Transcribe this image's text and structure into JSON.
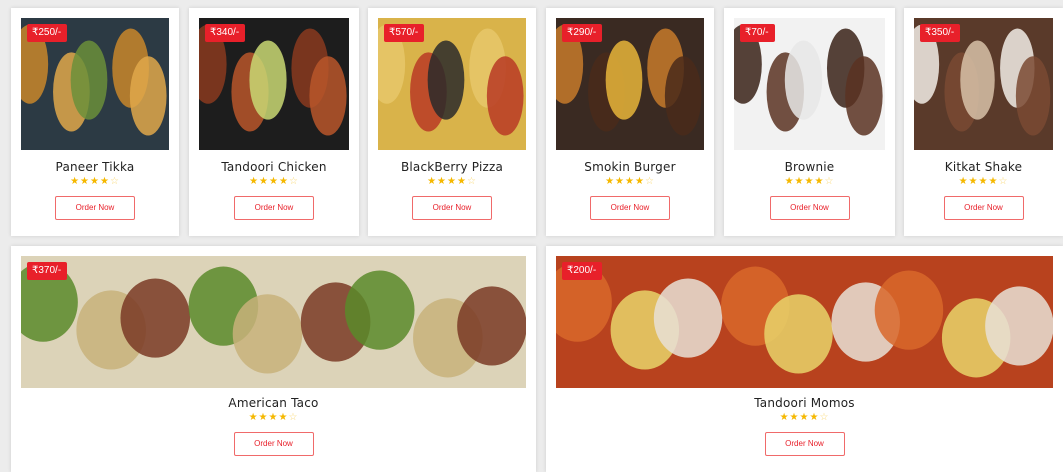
{
  "top_row": [
    {
      "name": "Paneer Tikka",
      "price": "₹250/-",
      "rating": 4,
      "order_label": "Order Now",
      "colors": [
        "#2c3a44",
        "#c9872a",
        "#e0a84a",
        "#6b8f3a"
      ]
    },
    {
      "name": "Tandoori Chicken",
      "price": "₹340/-",
      "rating": 4,
      "order_label": "Order Now",
      "colors": [
        "#1d1d1d",
        "#8a3a1e",
        "#b8562a",
        "#c9d873"
      ]
    },
    {
      "name": "BlackBerry Pizza",
      "price": "₹570/-",
      "rating": 4,
      "order_label": "Order Now",
      "colors": [
        "#d9b34a",
        "#e6c76a",
        "#b83a24",
        "#2a2a2a"
      ]
    },
    {
      "name": "Smokin Burger",
      "price": "₹290/-",
      "rating": 4,
      "order_label": "Order Now",
      "colors": [
        "#3a2a22",
        "#c77a2a",
        "#4a2a1a",
        "#e8b53a"
      ]
    },
    {
      "name": "Brownie",
      "price": "₹70/-",
      "rating": 4,
      "order_label": "Order Now",
      "colors": [
        "#f2f2f2",
        "#3a2218",
        "#5a3322",
        "#e8e8e8"
      ]
    },
    {
      "name": "Kitkat Shake",
      "price": "₹350/-",
      "rating": 4,
      "order_label": "Order Now",
      "colors": [
        "#5a3a2a",
        "#f2ede6",
        "#7a4a32",
        "#d8c2a8"
      ]
    }
  ],
  "bottom_row": [
    {
      "name": "American Taco",
      "price": "₹370/-",
      "rating": 4,
      "order_label": "Order Now",
      "colors": [
        "#dcd3b8",
        "#5a8a2a",
        "#c8b27a",
        "#7a3a24"
      ]
    },
    {
      "name": "Tandoori Momos",
      "price": "₹200/-",
      "rating": 4,
      "order_label": "Order Now",
      "colors": [
        "#b8421e",
        "#d8672a",
        "#e8d36a",
        "#e8e0d6"
      ]
    }
  ],
  "star_glyph_on": "★",
  "star_glyph_off": "☆",
  "accent_color": "#e8202a"
}
